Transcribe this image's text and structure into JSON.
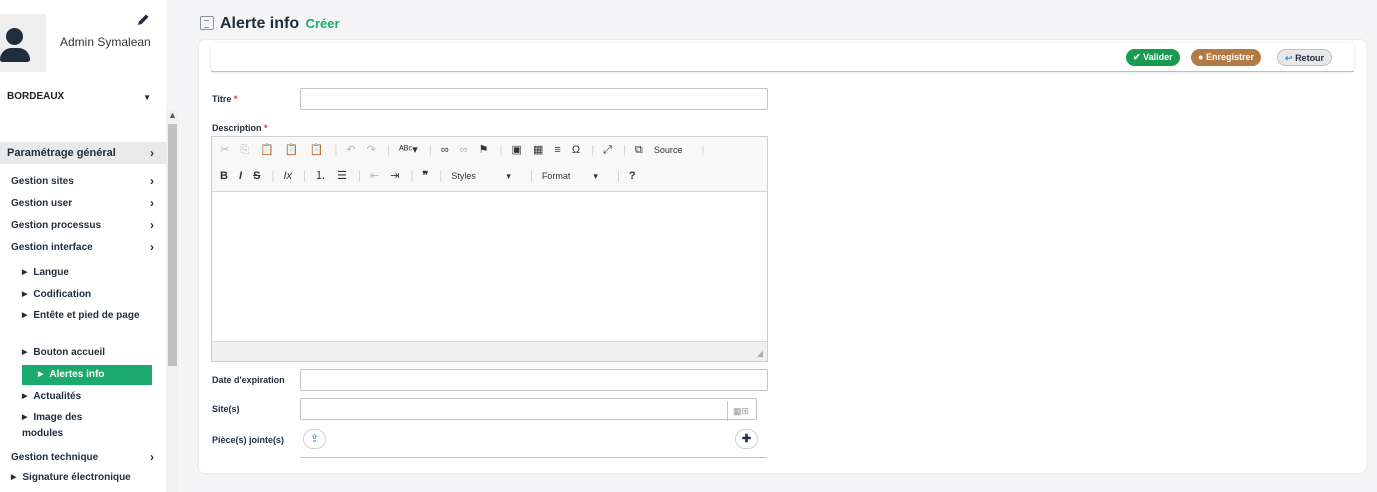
{
  "sidebar": {
    "username": "Admin Symalean",
    "site": "BORDEAUX",
    "section": "Paramétrage général",
    "items": [
      {
        "label": "Gestion sites"
      },
      {
        "label": "Gestion user"
      },
      {
        "label": "Gestion processus"
      },
      {
        "label": "Gestion interface"
      }
    ],
    "sub_items": [
      {
        "label": "Langue"
      },
      {
        "label": "Codification"
      },
      {
        "label": "Entête et pied de page"
      },
      {
        "label": "Bouton accueil"
      },
      {
        "label": "Alertes info"
      },
      {
        "label": "Actualités"
      },
      {
        "label": "Image des modules"
      }
    ],
    "technique": "Gestion technique",
    "signature": "Signature électronique"
  },
  "header": {
    "title": "Alerte info",
    "mode": "Créer"
  },
  "toolbar": {
    "validate_label": "Valider",
    "save_label": "Enregistrer",
    "back_label": "Retour"
  },
  "form": {
    "title_label": "Titre",
    "description_label": "Description",
    "required_mark": "*",
    "expiration_label": "Date d'expiration",
    "sites_label": "Site(s)",
    "attachments_label": "Pièce(s) jointe(s)"
  },
  "editor": {
    "source_label": "Source",
    "styles_label": "Styles",
    "format_label": "Format"
  },
  "colors": {
    "accent": "#1aaa6e",
    "validate": "#1a9b50",
    "save": "#b47a45",
    "navy": "#1f2d3d"
  }
}
